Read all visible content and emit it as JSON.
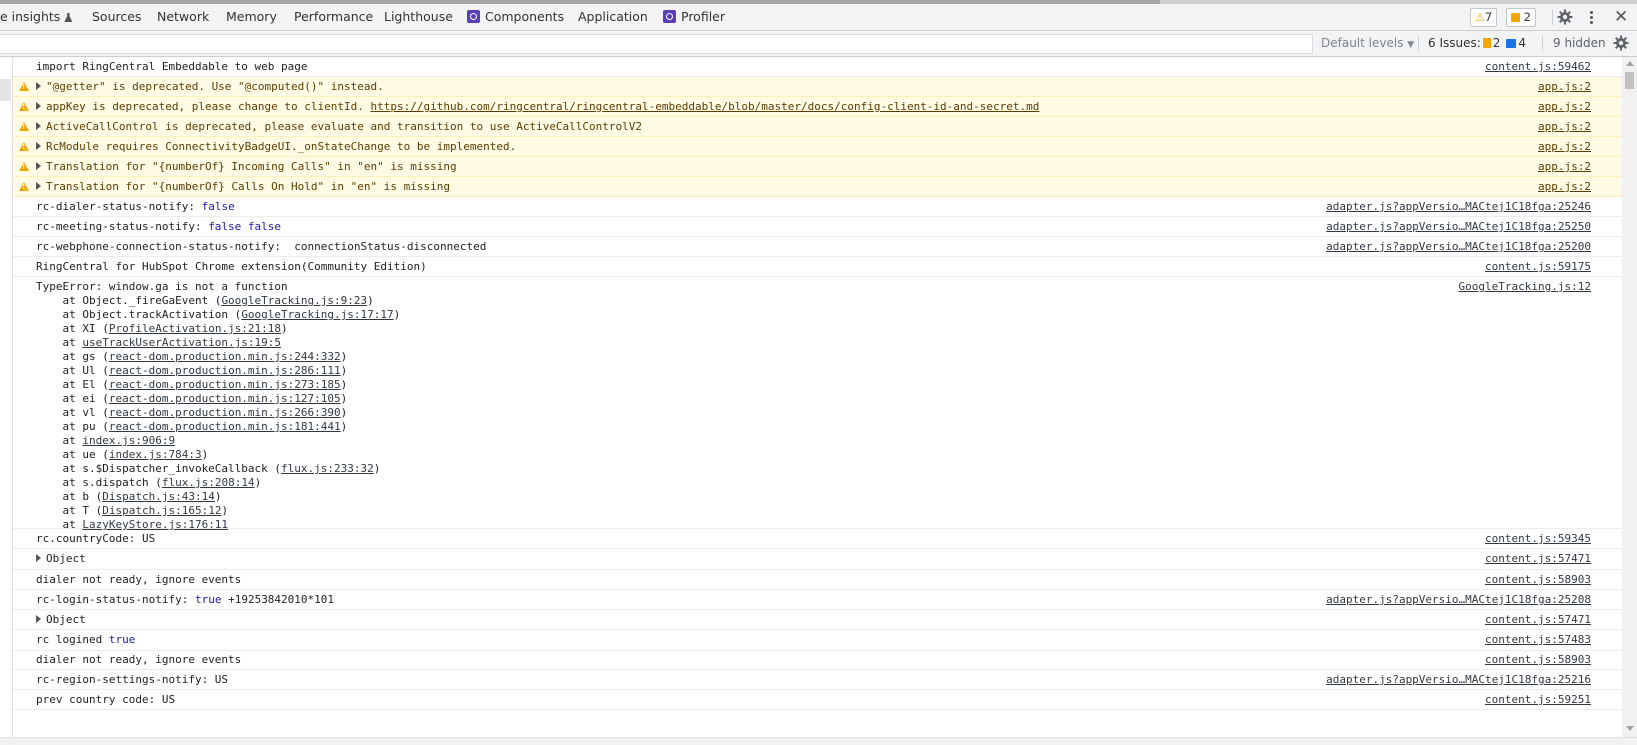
{
  "tabs": [
    {
      "label": "e insights"
    },
    {
      "label": "Sources"
    },
    {
      "label": "Network"
    },
    {
      "label": "Memory"
    },
    {
      "label": "Performance"
    },
    {
      "label": "Lighthouse"
    },
    {
      "label": "Components"
    },
    {
      "label": "Application"
    },
    {
      "label": "Profiler"
    }
  ],
  "counters": {
    "warnings": "7",
    "messages": "2"
  },
  "toolbar": {
    "levels_label": "Default levels",
    "issues_prefix": "6 Issues:",
    "issues_warn": "2",
    "issues_info": "4",
    "hidden_label": "9 hidden"
  },
  "logs": [
    {
      "type": "info",
      "text": "import RingCentral Embeddable to web page",
      "source": "content.js:59462"
    },
    {
      "type": "warn",
      "expandable": true,
      "text": "\"@getter\" is deprecated. Use \"@computed()\" instead.",
      "source": "app.js:2"
    },
    {
      "type": "warn",
      "expandable": true,
      "text": "appKey is deprecated, please change to clientId. ",
      "link": "https://github.com/ringcentral/ringcentral-embeddable/blob/master/docs/config-client-id-and-secret.md",
      "source": "app.js:2"
    },
    {
      "type": "warn",
      "expandable": true,
      "text": "ActiveCallControl is deprecated, please evaluate and transition to use ActiveCallControlV2",
      "source": "app.js:2"
    },
    {
      "type": "warn",
      "expandable": true,
      "text": "RcModule requires ConnectivityBadgeUI._onStateChange to be implemented.",
      "source": "app.js:2"
    },
    {
      "type": "warn",
      "expandable": true,
      "text": "Translation for \"{numberOf} Incoming Calls\" in \"en\" is missing",
      "source": "app.js:2"
    },
    {
      "type": "warn",
      "expandable": true,
      "text": "Translation for \"{numberOf} Calls On Hold\" in \"en\" is missing",
      "source": "app.js:2"
    },
    {
      "type": "info",
      "text": "rc-dialer-status-notify: ",
      "value": "false",
      "source": "adapter.js?appVersio…MACtej1C18fga:25246"
    },
    {
      "type": "info",
      "text": "rc-meeting-status-notify: ",
      "value": "false false",
      "source": "adapter.js?appVersio…MACtej1C18fga:25250"
    },
    {
      "type": "info",
      "text": "rc-webphone-connection-status-notify:  connectionStatus-disconnected",
      "source": "adapter.js?appVersio…MACtej1C18fga:25200"
    },
    {
      "type": "info",
      "text": "RingCentral for HubSpot Chrome extension(Community Edition)",
      "source": "content.js:59175"
    },
    {
      "type": "error",
      "text": "TypeError: window.ga is not a function",
      "source": "GoogleTracking.js:12",
      "stack": [
        {
          "pre": "    at Object._fireGaEvent (",
          "link": "GoogleTracking.js:9:23",
          "post": ")"
        },
        {
          "pre": "    at Object.trackActivation (",
          "link": "GoogleTracking.js:17:17",
          "post": ")"
        },
        {
          "pre": "    at XI (",
          "link": "ProfileActivation.js:21:18",
          "post": ")"
        },
        {
          "pre": "    at ",
          "link": "useTrackUserActivation.js:19:5",
          "post": ""
        },
        {
          "pre": "    at gs (",
          "link": "react-dom.production.min.js:244:332",
          "post": ")"
        },
        {
          "pre": "    at Ul (",
          "link": "react-dom.production.min.js:286:111",
          "post": ")"
        },
        {
          "pre": "    at El (",
          "link": "react-dom.production.min.js:273:185",
          "post": ")"
        },
        {
          "pre": "    at ei (",
          "link": "react-dom.production.min.js:127:105",
          "post": ")"
        },
        {
          "pre": "    at vl (",
          "link": "react-dom.production.min.js:266:390",
          "post": ")"
        },
        {
          "pre": "    at pu (",
          "link": "react-dom.production.min.js:181:441",
          "post": ")"
        },
        {
          "pre": "    at ",
          "link": "index.js:906:9",
          "post": ""
        },
        {
          "pre": "    at ue (",
          "link": "index.js:784:3",
          "post": ")"
        },
        {
          "pre": "    at s.$Dispatcher_invokeCallback (",
          "link": "flux.js:233:32",
          "post": ")"
        },
        {
          "pre": "    at s.dispatch (",
          "link": "flux.js:208:14",
          "post": ")"
        },
        {
          "pre": "    at b (",
          "link": "Dispatch.js:43:14",
          "post": ")"
        },
        {
          "pre": "    at T (",
          "link": "Dispatch.js:165:12",
          "post": ")"
        },
        {
          "pre": "    at ",
          "link": "LazyKeyStore.js:176:11",
          "post": ""
        }
      ]
    },
    {
      "type": "info",
      "text": "rc.countryCode: US",
      "source": "content.js:59345"
    },
    {
      "type": "info",
      "expandable": true,
      "text": "Object",
      "source": "content.js:57471"
    },
    {
      "type": "info",
      "text": "dialer not ready, ignore events",
      "source": "content.js:58903"
    },
    {
      "type": "info",
      "text": "rc-login-status-notify: ",
      "value": "true",
      "text2": " +19253842010*101",
      "source": "adapter.js?appVersio…MACtej1C18fga:25208"
    },
    {
      "type": "info",
      "expandable": true,
      "text": "Object",
      "source": "content.js:57471"
    },
    {
      "type": "info",
      "text": "rc logined ",
      "value": "true",
      "source": "content.js:57483"
    },
    {
      "type": "info",
      "text": "dialer not ready, ignore events",
      "source": "content.js:58903"
    },
    {
      "type": "info",
      "text": "rc-region-settings-notify: US",
      "source": "adapter.js?appVersio…MACtej1C18fga:25216"
    },
    {
      "type": "info",
      "text": "prev country code: US",
      "source": "content.js:59251"
    }
  ]
}
